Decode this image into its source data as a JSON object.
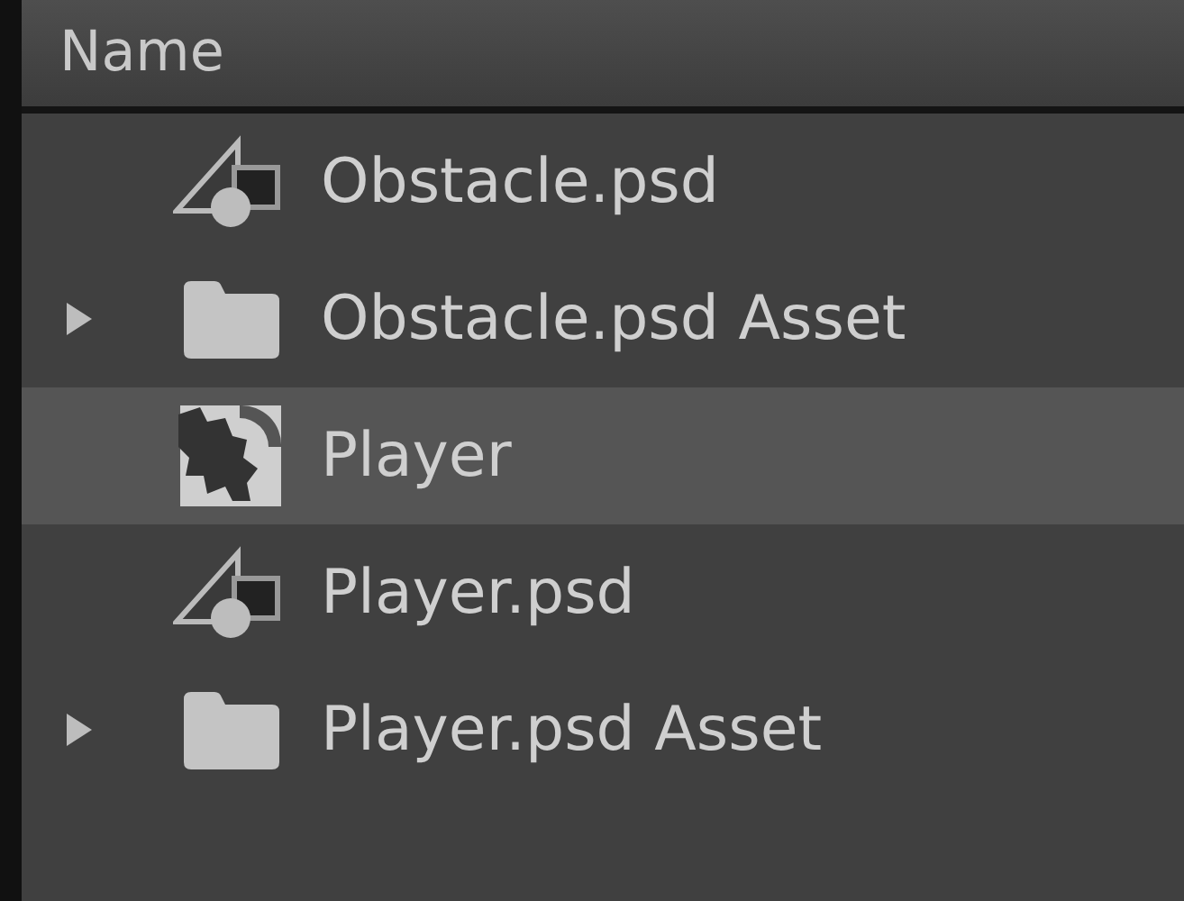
{
  "header": {
    "label": "Name"
  },
  "items": [
    {
      "kind": "psd",
      "label": "Obstacle.psd",
      "selected": false
    },
    {
      "kind": "folder",
      "label": "Obstacle.psd Asset",
      "selected": false,
      "expanded": false
    },
    {
      "kind": "comp",
      "label": "Player",
      "selected": true
    },
    {
      "kind": "psd",
      "label": "Player.psd",
      "selected": false
    },
    {
      "kind": "folder",
      "label": "Player.psd Asset",
      "selected": false,
      "expanded": false
    }
  ]
}
